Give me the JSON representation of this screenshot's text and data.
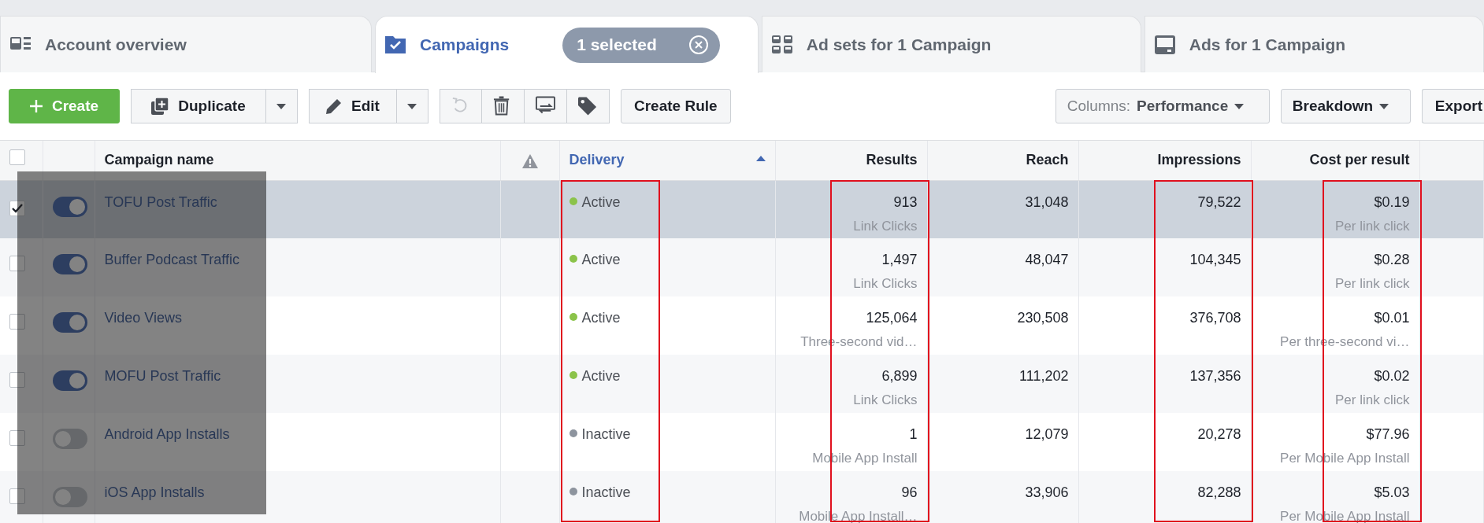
{
  "tabs": [
    {
      "kind": "overview",
      "label": "Account overview",
      "selected": false
    },
    {
      "kind": "campaigns",
      "label": "Campaigns",
      "selected": true,
      "badge": "1 selected"
    },
    {
      "kind": "adsets",
      "label": "Ad sets for 1 Campaign",
      "selected": false
    },
    {
      "kind": "ads",
      "label": "Ads for 1 Campaign",
      "selected": false
    }
  ],
  "toolbar": {
    "create": "Create",
    "duplicate": "Duplicate",
    "edit": "Edit",
    "icon_buttons": [
      {
        "kind": "undo",
        "disabled": true
      },
      {
        "kind": "delete",
        "disabled": false
      },
      {
        "kind": "abtest",
        "disabled": false
      },
      {
        "kind": "tag",
        "disabled": false
      }
    ],
    "create_rule": "Create Rule",
    "columns_prefix": "Columns:",
    "columns_value": "Performance",
    "breakdown": "Breakdown",
    "export": "Export"
  },
  "table": {
    "select_all_checked": false,
    "columns": [
      {
        "kind": "check"
      },
      {
        "kind": "toggle"
      },
      {
        "kind": "name",
        "label": "Campaign name",
        "sorted": false,
        "highlighted": false
      },
      {
        "kind": "warn"
      },
      {
        "kind": "delivery",
        "label": "Delivery",
        "sorted": true,
        "highlighted": true
      },
      {
        "kind": "results",
        "label": "Results",
        "sorted": false,
        "highlighted": true
      },
      {
        "kind": "reach",
        "label": "Reach",
        "sorted": false,
        "highlighted": false
      },
      {
        "kind": "impressions",
        "label": "Impressions",
        "sorted": false,
        "highlighted": true
      },
      {
        "kind": "cost",
        "label": "Cost per result",
        "sorted": false,
        "highlighted": true
      }
    ],
    "name_column_masked": true,
    "rows": [
      {
        "selected": true,
        "on": true,
        "name": "TOFU Post Traffic",
        "delivery": "Active",
        "color": "#8bc34a",
        "results": "913",
        "results_type": "Link Clicks",
        "reach": "31,048",
        "impressions": "79,522",
        "cost": "$0.19",
        "cost_type": "Per link click"
      },
      {
        "selected": false,
        "on": true,
        "name": "Buffer Podcast Traffic",
        "delivery": "Active",
        "color": "#8bc34a",
        "results": "1,497",
        "results_type": "Link Clicks",
        "reach": "48,047",
        "impressions": "104,345",
        "cost": "$0.28",
        "cost_type": "Per link click"
      },
      {
        "selected": false,
        "on": true,
        "name": "Video Views",
        "delivery": "Active",
        "color": "#8bc34a",
        "results": "125,064",
        "results_type": "Three-second vid…",
        "reach": "230,508",
        "impressions": "376,708",
        "cost": "$0.01",
        "cost_type": "Per three-second vi…"
      },
      {
        "selected": false,
        "on": true,
        "name": "MOFU Post Traffic",
        "delivery": "Active",
        "color": "#8bc34a",
        "results": "6,899",
        "results_type": "Link Clicks",
        "reach": "111,202",
        "impressions": "137,356",
        "cost": "$0.02",
        "cost_type": "Per link click"
      },
      {
        "selected": false,
        "on": false,
        "name": "Android App Installs",
        "delivery": "Inactive",
        "color": "#8d949e",
        "results": "1",
        "results_type": "Mobile App Install",
        "reach": "12,079",
        "impressions": "20,278",
        "cost": "$77.96",
        "cost_type": "Per Mobile App Install"
      },
      {
        "selected": false,
        "on": false,
        "name": "iOS App Installs",
        "delivery": "Inactive",
        "color": "#8d949e",
        "results": "96",
        "results_type": "Mobile App Install…",
        "reach": "33,906",
        "impressions": "82,288",
        "cost": "$5.03",
        "cost_type": "Per Mobile App Install"
      }
    ]
  }
}
